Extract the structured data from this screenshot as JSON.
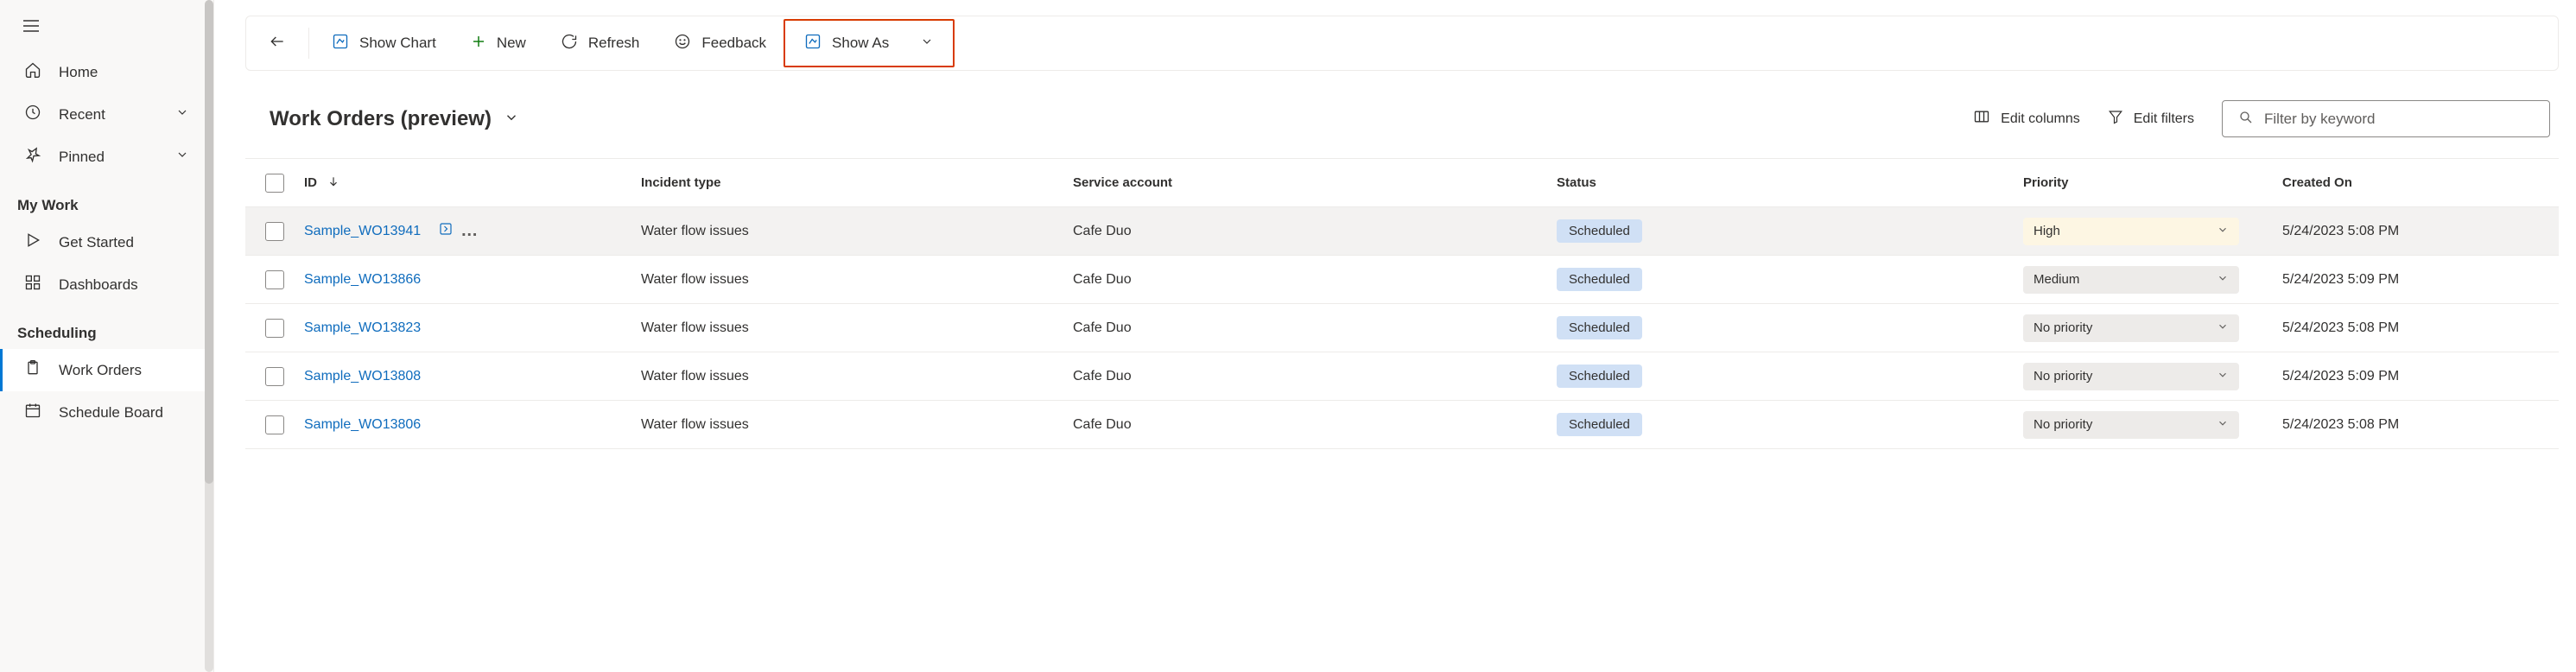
{
  "sidebar": {
    "home": "Home",
    "recent": "Recent",
    "pinned": "Pinned",
    "section_mywork": "My Work",
    "get_started": "Get Started",
    "dashboards": "Dashboards",
    "section_scheduling": "Scheduling",
    "work_orders": "Work Orders",
    "schedule_board": "Schedule Board"
  },
  "commandbar": {
    "show_chart": "Show Chart",
    "new": "New",
    "refresh": "Refresh",
    "feedback": "Feedback",
    "show_as": "Show As"
  },
  "view": {
    "title": "Work Orders (preview)",
    "edit_columns": "Edit columns",
    "edit_filters": "Edit filters",
    "filter_placeholder": "Filter by keyword"
  },
  "columns": {
    "id": "ID",
    "incident": "Incident type",
    "service": "Service account",
    "status": "Status",
    "priority": "Priority",
    "created": "Created On"
  },
  "rows": [
    {
      "id": "Sample_WO13941",
      "incident": "Water flow issues",
      "service": "Cafe Duo",
      "status": "Scheduled",
      "priority": "High",
      "priority_class": "priority-high",
      "created": "5/24/2023 5:08 PM"
    },
    {
      "id": "Sample_WO13866",
      "incident": "Water flow issues",
      "service": "Cafe Duo",
      "status": "Scheduled",
      "priority": "Medium",
      "priority_class": "priority-medium",
      "created": "5/24/2023 5:09 PM"
    },
    {
      "id": "Sample_WO13823",
      "incident": "Water flow issues",
      "service": "Cafe Duo",
      "status": "Scheduled",
      "priority": "No priority",
      "priority_class": "priority-none",
      "created": "5/24/2023 5:08 PM"
    },
    {
      "id": "Sample_WO13808",
      "incident": "Water flow issues",
      "service": "Cafe Duo",
      "status": "Scheduled",
      "priority": "No priority",
      "priority_class": "priority-none",
      "created": "5/24/2023 5:09 PM"
    },
    {
      "id": "Sample_WO13806",
      "incident": "Water flow issues",
      "service": "Cafe Duo",
      "status": "Scheduled",
      "priority": "No priority",
      "priority_class": "priority-none",
      "created": "5/24/2023 5:08 PM"
    }
  ]
}
